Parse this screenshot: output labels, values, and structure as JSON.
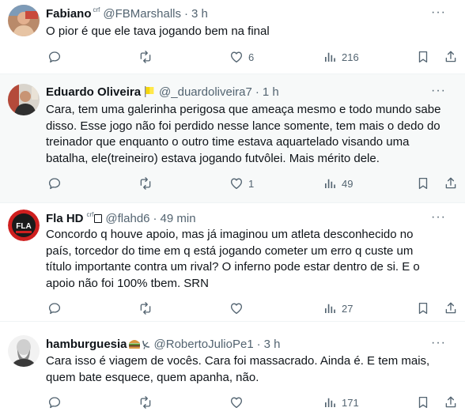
{
  "tweets": [
    {
      "name": "Fabiano",
      "badge": "crf",
      "handle": "@FBMarshalls",
      "time": "3 h",
      "text": "O pior é que ele tava jogando bem na final",
      "replies": "",
      "reposts": "",
      "likes": "6",
      "views": "216"
    },
    {
      "name": "Eduardo Oliveira",
      "handle": "@_duardoliveira7",
      "time": "1 h",
      "text": "Cara, tem uma galerinha perigosa que ameaça mesmo e todo mundo sabe disso. Esse jogo não foi perdido nesse lance somente, tem mais o dedo do treinador que enquanto o outro time estava aquartelado visando uma batalha, ele(treineiro) estava jogando futvôlei. Mais mérito dele.",
      "replies": "",
      "reposts": "",
      "likes": "1",
      "views": "49"
    },
    {
      "name": "Fla HD",
      "badge": "crf",
      "handle": "@flahd6",
      "time": "49 min",
      "avatar_text": "FLA",
      "text": "Concordo q houve apoio, mas já imaginou um atleta desconhecido no país, torcedor do time em q está jogando cometer um erro q custe um título importante contra um rival? O inferno pode estar dentro de si. E o apoio não foi 100% tbem. SRN",
      "replies": "",
      "reposts": "",
      "likes": "",
      "views": "27"
    },
    {
      "name": "hamburguesia",
      "handle": "@RobertoJulioPe1",
      "time": "3 h",
      "text": "Cara isso é viagem de vocês. Cara foi massacrado. Ainda é. E tem mais, quem bate esquece, quem apanha, não.",
      "replies": "",
      "reposts": "",
      "likes": "",
      "views": "171"
    }
  ],
  "ui": {
    "separator": "·",
    "more": "···"
  },
  "icons": [
    "reply-icon",
    "repost-icon",
    "like-icon",
    "views-icon",
    "bookmark-icon",
    "share-icon",
    "more-icon"
  ],
  "colors": {
    "text": "#0f1419",
    "secondary": "#536471",
    "highlight_bg": "#f7f9f9",
    "divider": "#eff3f4"
  }
}
